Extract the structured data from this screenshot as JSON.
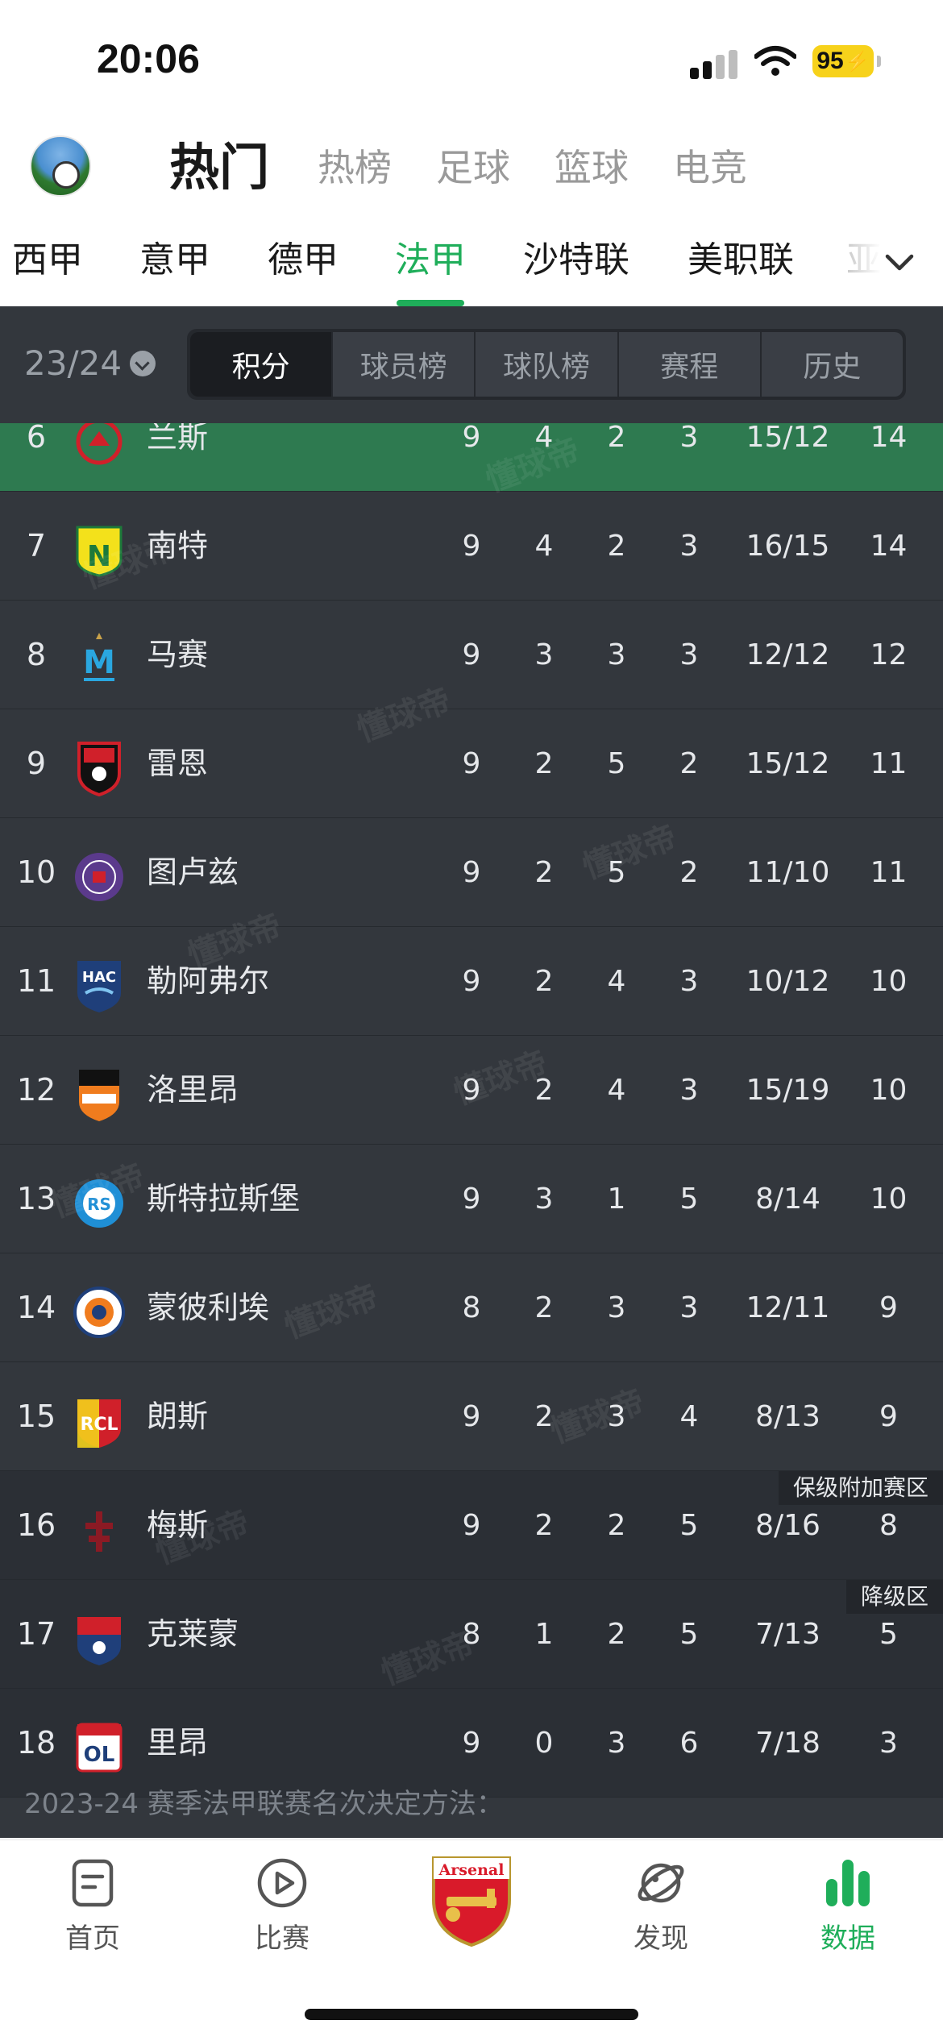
{
  "status_bar": {
    "time": "20:06",
    "battery": "95"
  },
  "top_nav": {
    "tabs": [
      "热门",
      "热榜",
      "足球",
      "篮球",
      "电竞"
    ],
    "active": "热门"
  },
  "league_tabs": {
    "items": [
      "西甲",
      "意甲",
      "德甲",
      "法甲",
      "沙特联",
      "美职联",
      "亚"
    ],
    "active": "法甲"
  },
  "standings": {
    "season": "23/24",
    "segments": [
      "积分",
      "球员榜",
      "球队榜",
      "赛程",
      "历史"
    ],
    "active_segment": "积分",
    "rows": [
      {
        "rank": "6",
        "team": "兰斯",
        "p": "9",
        "w": "4",
        "d": "2",
        "l": "3",
        "gf_ga": "15/12",
        "pts": "14",
        "logo": "reims-crest",
        "highlight": "green"
      },
      {
        "rank": "7",
        "team": "南特",
        "p": "9",
        "w": "4",
        "d": "2",
        "l": "3",
        "gf_ga": "16/15",
        "pts": "14",
        "logo": "nantes-crest"
      },
      {
        "rank": "8",
        "team": "马赛",
        "p": "9",
        "w": "3",
        "d": "3",
        "l": "3",
        "gf_ga": "12/12",
        "pts": "12",
        "logo": "marseille-crest"
      },
      {
        "rank": "9",
        "team": "雷恩",
        "p": "9",
        "w": "2",
        "d": "5",
        "l": "2",
        "gf_ga": "15/12",
        "pts": "11",
        "logo": "rennes-crest"
      },
      {
        "rank": "10",
        "team": "图卢兹",
        "p": "9",
        "w": "2",
        "d": "5",
        "l": "2",
        "gf_ga": "11/10",
        "pts": "11",
        "logo": "toulouse-crest"
      },
      {
        "rank": "11",
        "team": "勒阿弗尔",
        "p": "9",
        "w": "2",
        "d": "4",
        "l": "3",
        "gf_ga": "10/12",
        "pts": "10",
        "logo": "le-havre-crest"
      },
      {
        "rank": "12",
        "team": "洛里昂",
        "p": "9",
        "w": "2",
        "d": "4",
        "l": "3",
        "gf_ga": "15/19",
        "pts": "10",
        "logo": "lorient-crest"
      },
      {
        "rank": "13",
        "team": "斯特拉斯堡",
        "p": "9",
        "w": "3",
        "d": "1",
        "l": "5",
        "gf_ga": "8/14",
        "pts": "10",
        "logo": "strasbourg-crest"
      },
      {
        "rank": "14",
        "team": "蒙彼利埃",
        "p": "8",
        "w": "2",
        "d": "3",
        "l": "3",
        "gf_ga": "12/11",
        "pts": "9",
        "logo": "montpellier-crest"
      },
      {
        "rank": "15",
        "team": "朗斯",
        "p": "9",
        "w": "2",
        "d": "3",
        "l": "4",
        "gf_ga": "8/13",
        "pts": "9",
        "logo": "lens-crest"
      },
      {
        "rank": "16",
        "team": "梅斯",
        "p": "9",
        "w": "2",
        "d": "2",
        "l": "5",
        "gf_ga": "8/16",
        "pts": "8",
        "logo": "metz-crest",
        "zone": "保级附加赛区",
        "highlight": "dark"
      },
      {
        "rank": "17",
        "team": "克莱蒙",
        "p": "8",
        "w": "1",
        "d": "2",
        "l": "5",
        "gf_ga": "7/13",
        "pts": "5",
        "logo": "clermont-crest",
        "zone": "降级区",
        "highlight": "dark"
      },
      {
        "rank": "18",
        "team": "里昂",
        "p": "9",
        "w": "0",
        "d": "3",
        "l": "6",
        "gf_ga": "7/18",
        "pts": "3",
        "logo": "lyon-crest",
        "highlight": "dark"
      }
    ],
    "note": "2023-24 赛季法甲联赛名次决定方法：",
    "watermark": "懂球帝"
  },
  "tab_bar": {
    "items": [
      {
        "label": "首页",
        "icon": "home-doc-icon"
      },
      {
        "label": "比赛",
        "icon": "play-circle-icon"
      },
      {
        "label": "",
        "icon": "arsenal-crest-icon"
      },
      {
        "label": "发现",
        "icon": "planet-icon"
      },
      {
        "label": "数据",
        "icon": "bar-chart-icon"
      }
    ],
    "active": "数据"
  },
  "colors": {
    "accent": "#1fae5a",
    "panel": "#33373d",
    "row_highlight": "#2e7a50"
  }
}
